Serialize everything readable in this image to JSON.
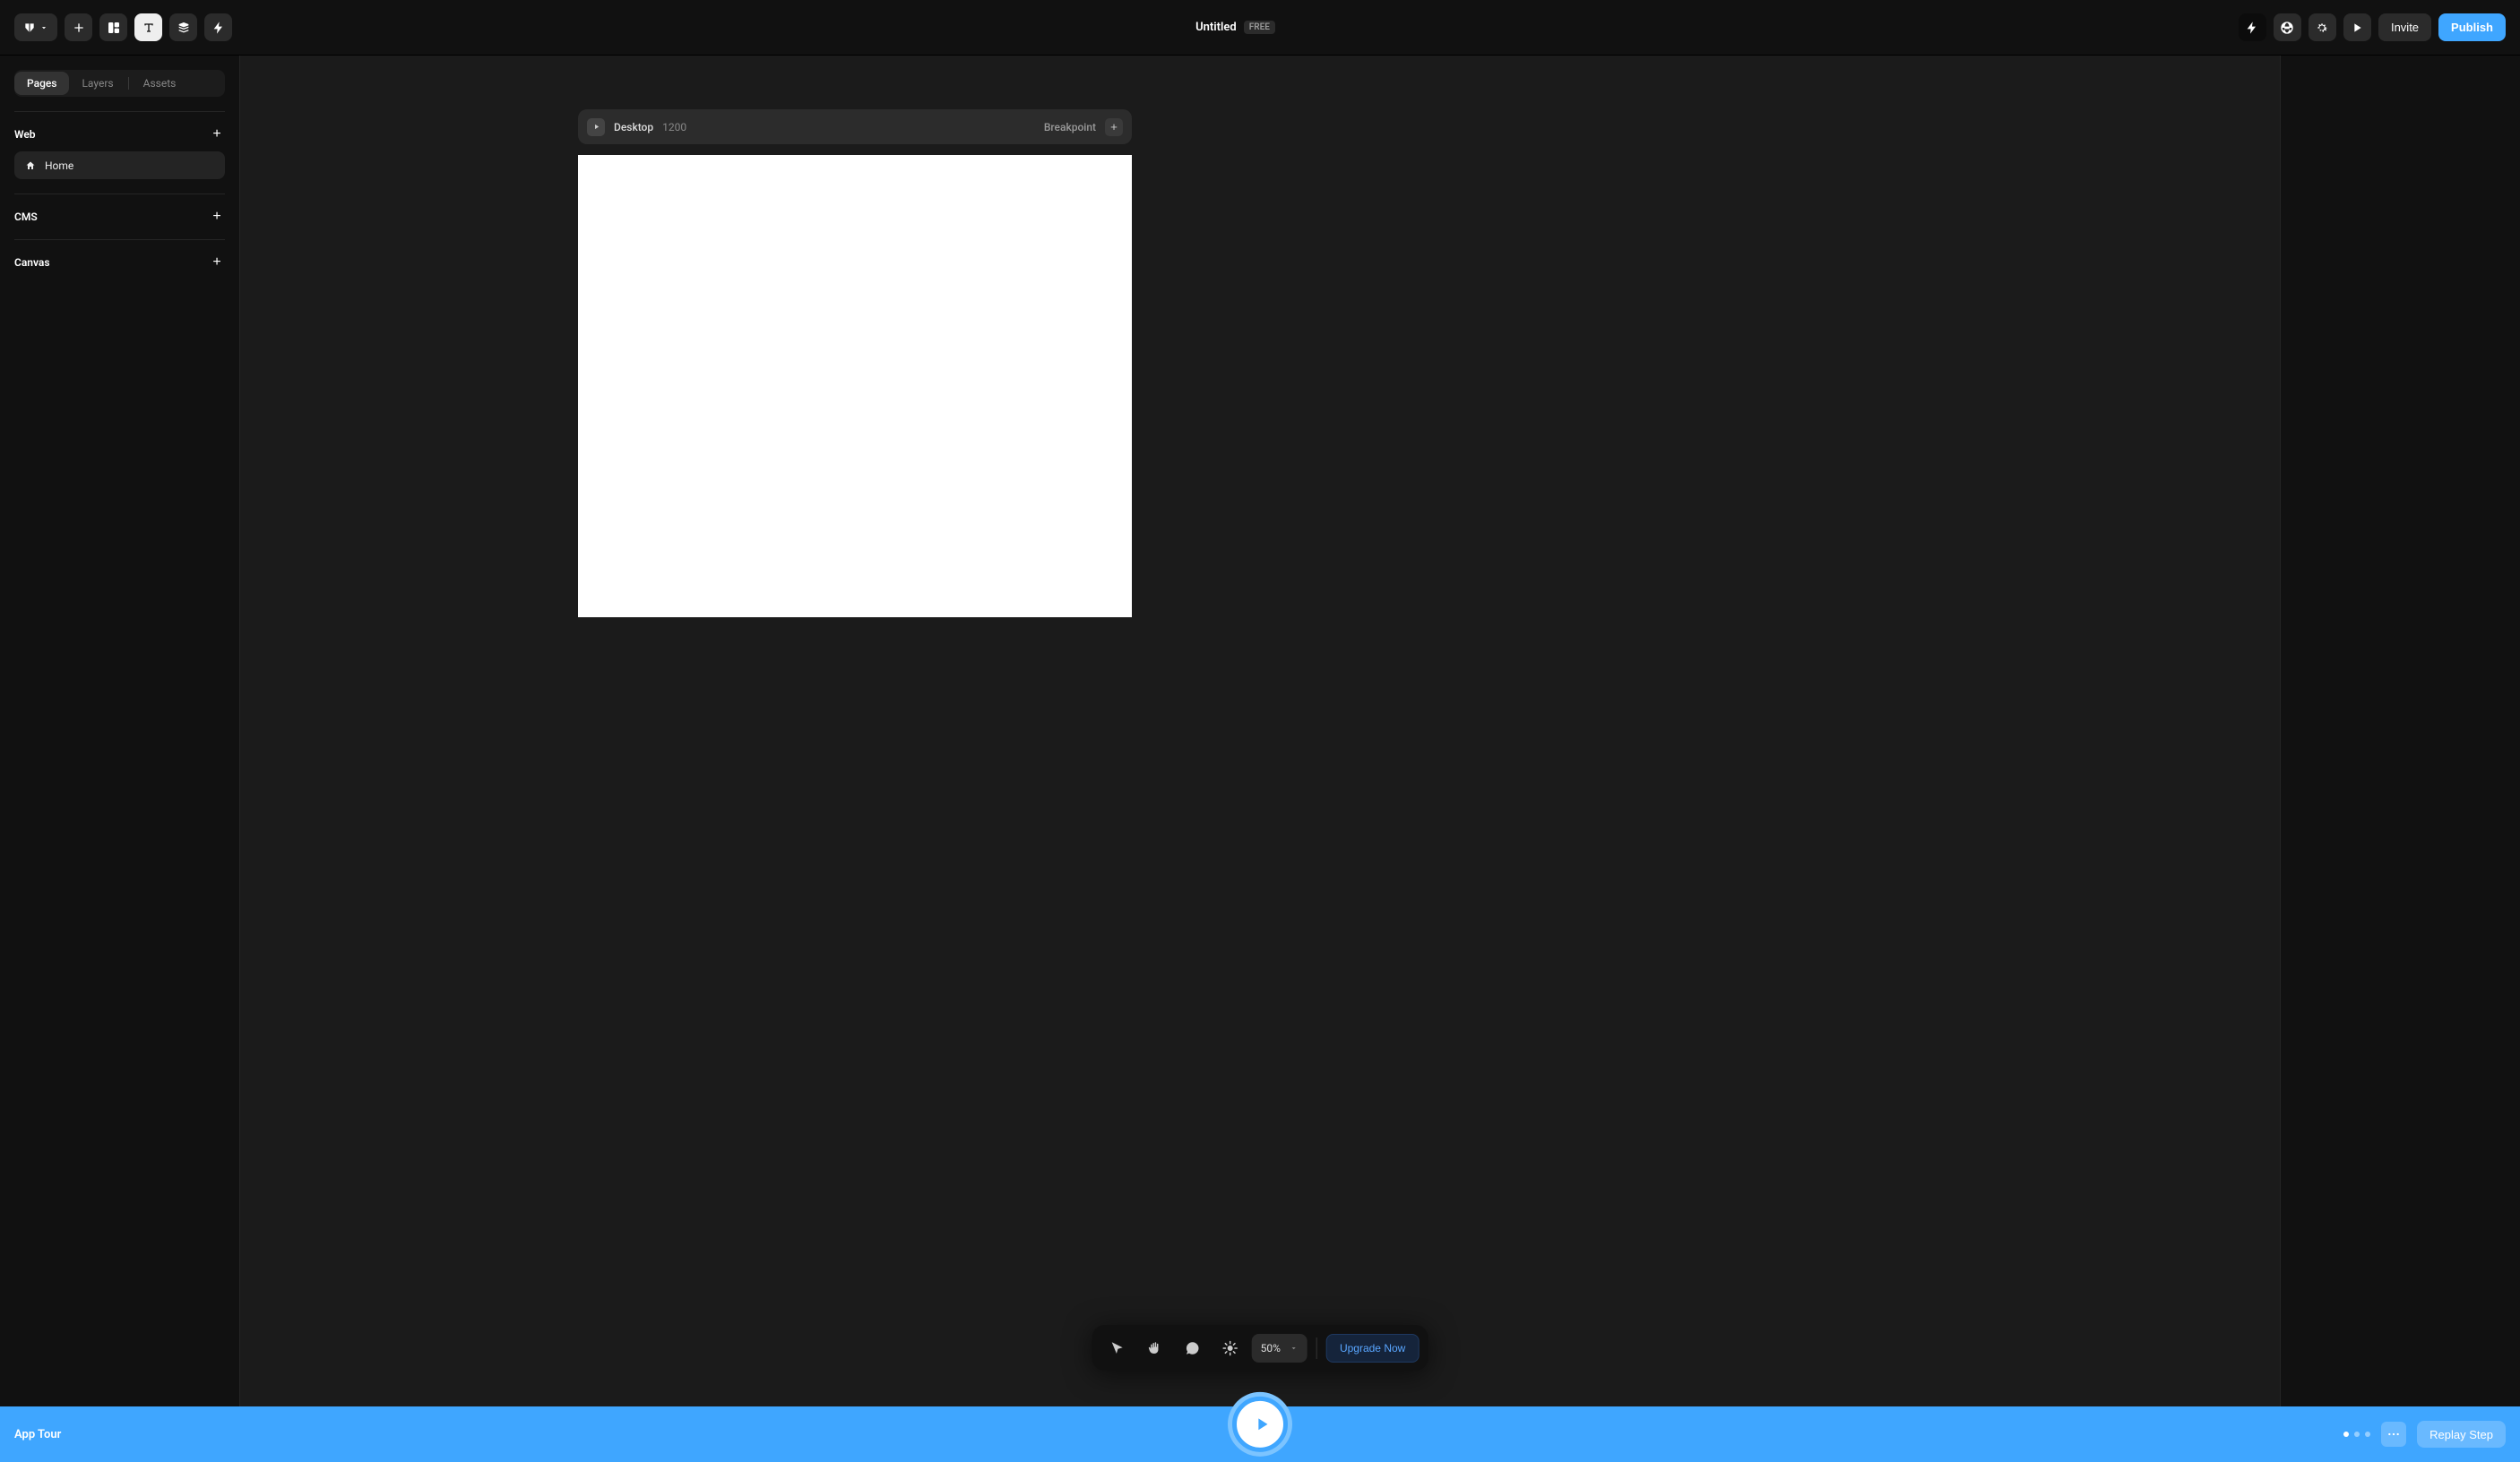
{
  "topbar": {
    "title": "Untitled",
    "plan_badge": "FREE",
    "invite_label": "Invite",
    "publish_label": "Publish"
  },
  "sidebar": {
    "tabs": {
      "pages": "Pages",
      "layers": "Layers",
      "assets": "Assets"
    },
    "sections": {
      "web": {
        "title": "Web",
        "home": "Home"
      },
      "cms": {
        "title": "CMS"
      },
      "canvas": {
        "title": "Canvas"
      }
    }
  },
  "frame": {
    "device_label": "Desktop",
    "width": "1200",
    "breakpoint_label": "Breakpoint"
  },
  "tools": {
    "zoom": "50%",
    "upgrade_label": "Upgrade Now"
  },
  "tour": {
    "title": "App Tour",
    "replay_label": "Replay Step",
    "dot_count": 3,
    "active_dot": 0
  }
}
